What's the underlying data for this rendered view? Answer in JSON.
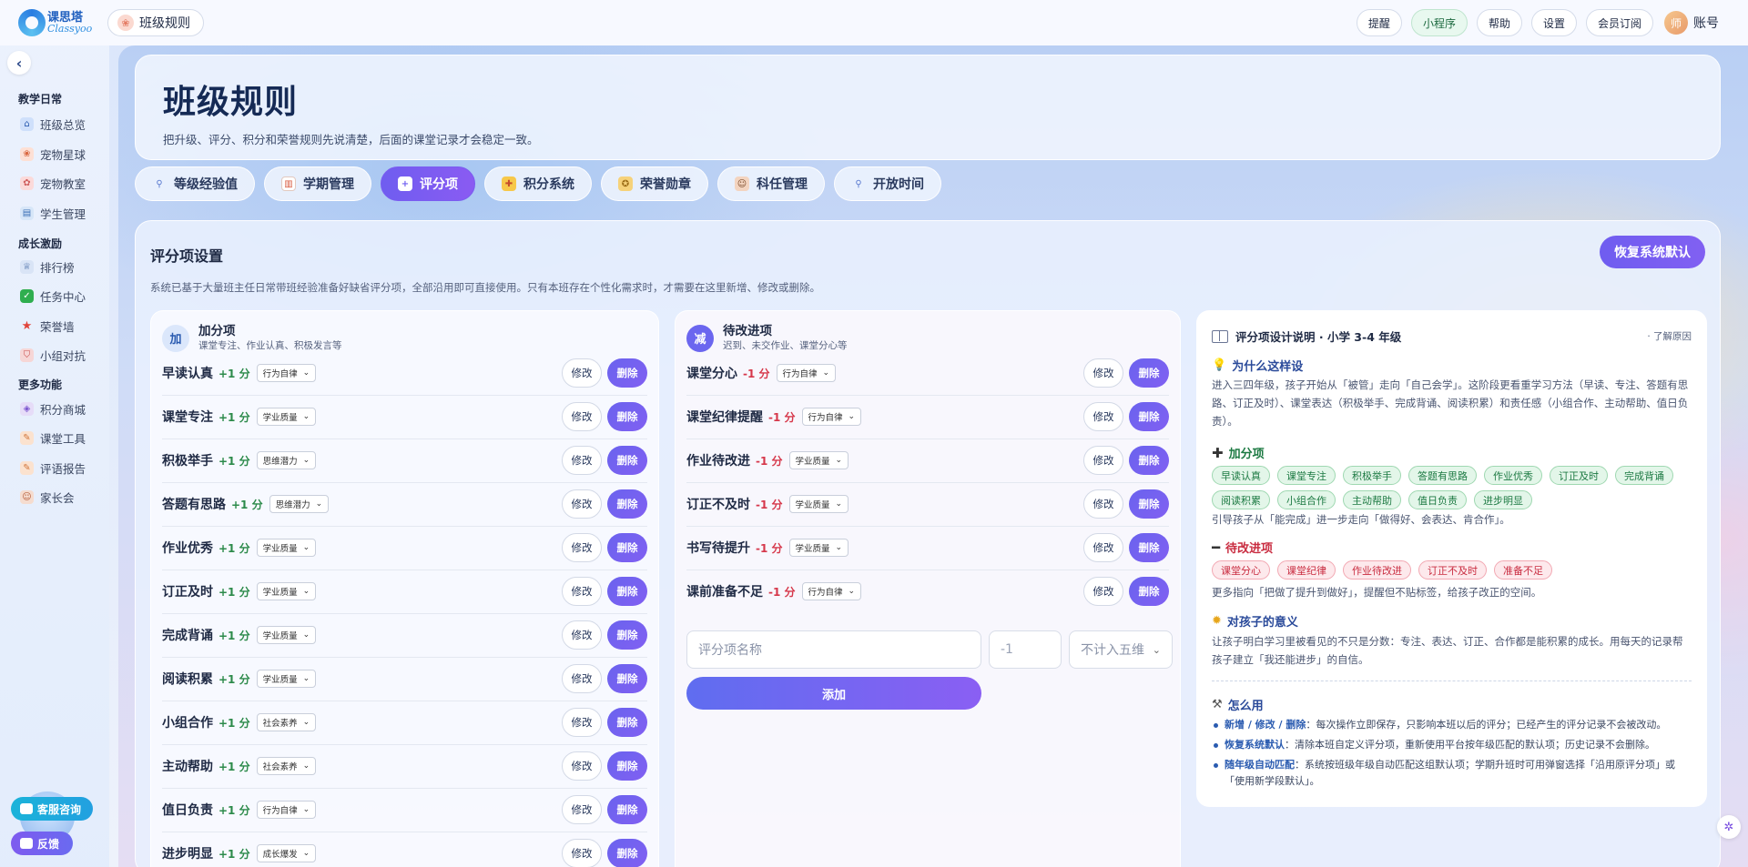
{
  "app": {
    "logo_cn": "课思塔",
    "logo_en": "Classyoo",
    "page_pill": "班级规则"
  },
  "topbar": {
    "buttons": [
      "提醒",
      "小程序",
      "帮助",
      "设置",
      "会员订阅"
    ],
    "avatar_text": "师",
    "account": "账号"
  },
  "sidebar": {
    "groups": [
      {
        "title": "教学日常",
        "items": [
          "班级总览",
          "宠物星球",
          "宠物教室",
          "学生管理"
        ]
      },
      {
        "title": "成长激励",
        "items": [
          "排行榜",
          "任务中心",
          "荣誉墙",
          "小组对抗"
        ]
      },
      {
        "title": "更多功能",
        "items": [
          "积分商城",
          "课堂工具",
          "评语报告",
          "家长会"
        ]
      }
    ],
    "service_label": "客服咨询",
    "feedback_label": "反馈"
  },
  "hero": {
    "title": "班级规则",
    "subtitle": "把升级、评分、积分和荣誉规则先说清楚，后面的课堂记录才会稳定一致。"
  },
  "tabs": [
    "等级经验值",
    "学期管理",
    "评分项",
    "积分系统",
    "荣誉勋章",
    "科任管理",
    "开放时间"
  ],
  "panel": {
    "title": "评分项设置",
    "restore": "恢复系统默认",
    "desc": "系统已基于大量班主任日常带班经验准备好缺省评分项，全部沿用即可直接使用。只有本班存在个性化需求时，才需要在这里新增、修改或删除。"
  },
  "plus_col": {
    "badge": "加",
    "title": "加分项",
    "sub": "课堂专注、作业认真、积极发言等",
    "edit": "修改",
    "del": "删除",
    "items": [
      {
        "name": "早读认真",
        "pts": "+1 分",
        "dim": "行为自律"
      },
      {
        "name": "课堂专注",
        "pts": "+1 分",
        "dim": "学业质量"
      },
      {
        "name": "积极举手",
        "pts": "+1 分",
        "dim": "思维潜力"
      },
      {
        "name": "答题有思路",
        "pts": "+1 分",
        "dim": "思维潜力"
      },
      {
        "name": "作业优秀",
        "pts": "+1 分",
        "dim": "学业质量"
      },
      {
        "name": "订正及时",
        "pts": "+1 分",
        "dim": "学业质量"
      },
      {
        "name": "完成背诵",
        "pts": "+1 分",
        "dim": "学业质量"
      },
      {
        "name": "阅读积累",
        "pts": "+1 分",
        "dim": "学业质量"
      },
      {
        "name": "小组合作",
        "pts": "+1 分",
        "dim": "社会素养"
      },
      {
        "name": "主动帮助",
        "pts": "+1 分",
        "dim": "社会素养"
      },
      {
        "name": "值日负责",
        "pts": "+1 分",
        "dim": "行为自律"
      },
      {
        "name": "进步明显",
        "pts": "+1 分",
        "dim": "成长爆发"
      }
    ]
  },
  "minus_col": {
    "badge": "减",
    "title": "待改进项",
    "sub": "迟到、未交作业、课堂分心等",
    "edit": "修改",
    "del": "删除",
    "items": [
      {
        "name": "课堂分心",
        "pts": "-1 分",
        "dim": "行为自律"
      },
      {
        "name": "课堂纪律提醒",
        "pts": "-1 分",
        "dim": "行为自律"
      },
      {
        "name": "作业待改进",
        "pts": "-1 分",
        "dim": "学业质量"
      },
      {
        "name": "订正不及时",
        "pts": "-1 分",
        "dim": "学业质量"
      },
      {
        "name": "书写待提升",
        "pts": "-1 分",
        "dim": "学业质量"
      },
      {
        "name": "课前准备不足",
        "pts": "-1 分",
        "dim": "行为自律"
      }
    ],
    "form": {
      "name_placeholder": "评分项名称",
      "score_placeholder": "-1",
      "dim_value": "不计入五维",
      "add_label": "添加"
    }
  },
  "info": {
    "title": "评分项设计说明 · 小学 3-4 年级",
    "more": "· 了解原因",
    "why_title": "为什么这样设",
    "why_text": "进入三四年级，孩子开始从「被管」走向「自己会学」。这阶段更看重学习方法（早读、专注、答题有思路、订正及时）、课堂表达（积极举手、完成背诵、阅读积累）和责任感（小组合作、主动帮助、值日负责）。",
    "plus_title": "加分项",
    "plus_chips": [
      "早读认真",
      "课堂专注",
      "积极举手",
      "答题有思路",
      "作业优秀",
      "订正及时",
      "完成背诵",
      "阅读积累",
      "小组合作",
      "主动帮助",
      "值日负责",
      "进步明显"
    ],
    "plus_note": "引导孩子从「能完成」进一步走向「做得好、会表达、肯合作」。",
    "minus_title": "待改进项",
    "minus_chips": [
      "课堂分心",
      "课堂纪律",
      "作业待改进",
      "订正不及时",
      "准备不足"
    ],
    "minus_note": "更多指向「把做了提升到做好」，提醒但不贴标签，给孩子改正的空间。",
    "meaning_title": "对孩子的意义",
    "meaning_text": "让孩子明白学习里被看见的不只是分数：专注、表达、订正、合作都是能积累的成长。用每天的记录帮孩子建立「我还能进步」的自信。",
    "howto_title": "怎么用",
    "howto": [
      {
        "k": "新增 / 修改 / 删除",
        "v": "：每次操作立即保存，只影响本班以后的评分；已经产生的评分记录不会被改动。"
      },
      {
        "k": "恢复系统默认",
        "v": "：清除本班自定义评分项，重新使用平台按年级匹配的默认项；历史记录不会删除。"
      },
      {
        "k": "随年级自动匹配",
        "v": "：系统按班级年级自动匹配这组默认项；学期升班时可用弹窗选择「沿用原评分项」或「使用新学段默认」。"
      }
    ]
  },
  "colors": {
    "accent": "#7060f0",
    "plus_pts": "#2c8a4a",
    "minus_pts": "#d6374a"
  }
}
